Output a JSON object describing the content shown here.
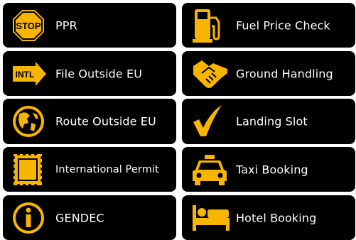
{
  "colors": {
    "accent": "#f7b500",
    "tile": "#000000",
    "text": "#ffffff"
  },
  "tiles": [
    {
      "label": "PPR",
      "icon": "stop-sign-icon"
    },
    {
      "label": "Fuel Price Check",
      "icon": "fuel-pump-icon"
    },
    {
      "label": "File Outside EU",
      "icon": "intl-arrow-icon"
    },
    {
      "label": "Ground Handling",
      "icon": "handshake-icon"
    },
    {
      "label": "Route Outside EU",
      "icon": "globe-icon"
    },
    {
      "label": "Landing Slot",
      "icon": "checkmark-icon"
    },
    {
      "label": "International Permit",
      "icon": "stamp-icon"
    },
    {
      "label": "Taxi Booking",
      "icon": "taxi-icon"
    },
    {
      "label": "GENDEC",
      "icon": "info-icon"
    },
    {
      "label": "Hotel Booking",
      "icon": "hotel-bed-icon"
    }
  ],
  "icon_text": {
    "stop": "STOP",
    "intl": "INTL"
  }
}
